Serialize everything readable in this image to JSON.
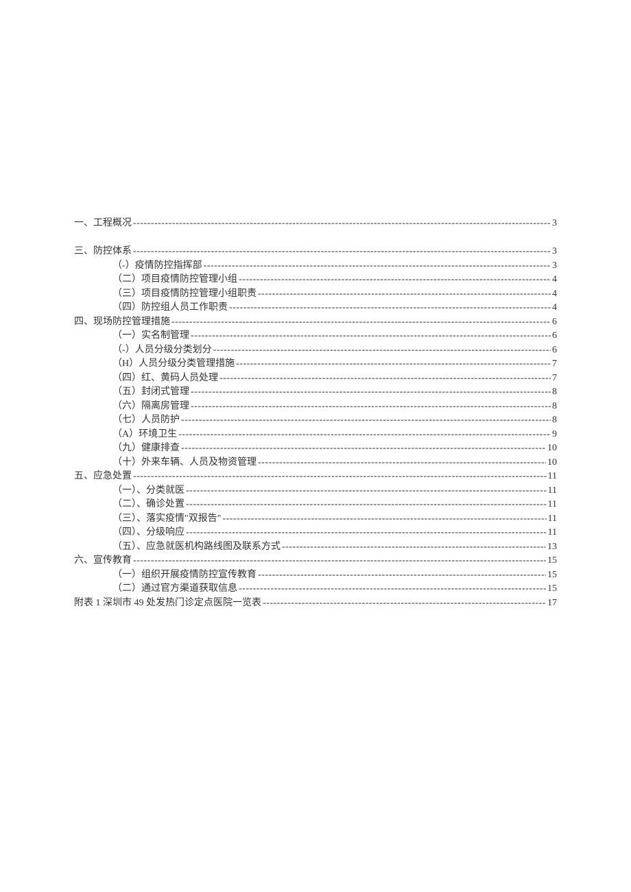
{
  "toc": [
    {
      "level": 0,
      "title": "一、工程概况",
      "page": "3"
    },
    {
      "level": 0,
      "title": "",
      "page": "",
      "spacer": true
    },
    {
      "level": 0,
      "title": "三、防控体系",
      "page": "3"
    },
    {
      "level": 1,
      "title": "（-）疫情防控指挥部",
      "page": "3"
    },
    {
      "level": 1,
      "title": "（二）项目疫情防控管理小组",
      "page": "4"
    },
    {
      "level": 1,
      "title": "（三）项目疫情防控管理小组职责",
      "page": "4"
    },
    {
      "level": 1,
      "title": "（四）防控组人员工作职责",
      "page": "4"
    },
    {
      "level": 0,
      "title": "四、现场防控管理措施",
      "page": "6"
    },
    {
      "level": 1,
      "title": "（一）实名制管理",
      "page": "6"
    },
    {
      "level": 1,
      "title": "（-）人员分级分类划分",
      "page": "6"
    },
    {
      "level": 1,
      "title": "（H）人员分级分类管理措施",
      "page": "7"
    },
    {
      "level": 1,
      "title": "（四）红、黄码人员处理",
      "page": "7"
    },
    {
      "level": 1,
      "title": "（五）封闭式管理",
      "page": "8"
    },
    {
      "level": 1,
      "title": "（六）隔离房管理",
      "page": "8"
    },
    {
      "level": 1,
      "title": "（七）人员防护",
      "page": "8"
    },
    {
      "level": 1,
      "title": "（A）环境卫生",
      "page": "9"
    },
    {
      "level": 1,
      "title": "（九）健康排查",
      "page": "10"
    },
    {
      "level": 1,
      "title": "（十）外来车辆、人员及物资管理",
      "page": "10"
    },
    {
      "level": 0,
      "title": "五、应急处置",
      "page": "11"
    },
    {
      "level": 1,
      "title": "（一）、分类就医",
      "page": "11"
    },
    {
      "level": 1,
      "title": "（二）、确诊处置",
      "page": "11"
    },
    {
      "level": 1,
      "title": "（三）、落实疫情\"双报告\"",
      "page": "11"
    },
    {
      "level": 1,
      "title": "（四）、分级响应",
      "page": "11"
    },
    {
      "level": 1,
      "title": "（五）、应急就医机构路线图及联系方式",
      "page": "13"
    },
    {
      "level": 0,
      "title": "六、宣传教育",
      "page": "15"
    },
    {
      "level": 1,
      "title": "（一）组织开展疫情防控宣传教育",
      "page": "15"
    },
    {
      "level": 1,
      "title": "（二）通过官方渠道获取信息",
      "page": "15"
    },
    {
      "level": 0,
      "title": "附表 1 深圳市 49 处发热门诊定点医院一览表 ",
      "page": "17"
    }
  ]
}
